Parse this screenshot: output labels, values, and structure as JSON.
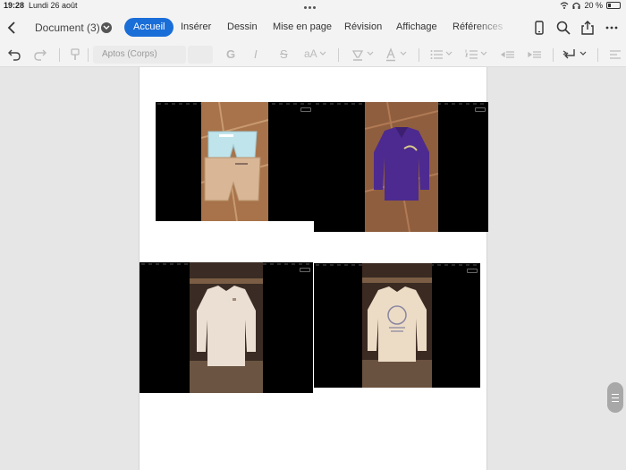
{
  "status_bar": {
    "time": "19:28",
    "date": "Lundi 26 août",
    "battery": "20 %"
  },
  "title_bar": {
    "document_title": "Document (3)",
    "tabs": [
      {
        "label": "Accueil",
        "active": true
      },
      {
        "label": "Insérer",
        "active": false
      },
      {
        "label": "Dessin",
        "active": false
      },
      {
        "label": "Mise en page",
        "active": false
      },
      {
        "label": "Révision",
        "active": false
      },
      {
        "label": "Affichage",
        "active": false
      },
      {
        "label": "Références",
        "active": false
      }
    ],
    "icons": [
      "back-icon",
      "phone-view-icon",
      "search-icon",
      "share-icon",
      "more-icon"
    ]
  },
  "ribbon": {
    "font_name": "Aptos (Corps)",
    "font_size": "",
    "bold": "G",
    "italic": "I",
    "strikethrough": "S",
    "change_case": "aA"
  },
  "document": {
    "photos": [
      {
        "subject": "shorts",
        "colors": [
          "#b07a4c",
          "#9d6d45",
          "#c8a07c"
        ]
      },
      {
        "subject": "purple-polo",
        "colors": [
          "#8d5b3c",
          "#4d2a8a",
          "#a27052"
        ]
      },
      {
        "subject": "white-shirt",
        "colors": [
          "#3b2d26",
          "#e8dccf",
          "#5a4638"
        ]
      },
      {
        "subject": "printed-sweater",
        "colors": [
          "#3a2a22",
          "#e9dac6",
          "#5b4535"
        ]
      }
    ]
  },
  "colors": {
    "accent": "#1a6ed8",
    "toolbar_bg": "#f3f3f3",
    "canvas_bg": "#e6e6e6"
  }
}
